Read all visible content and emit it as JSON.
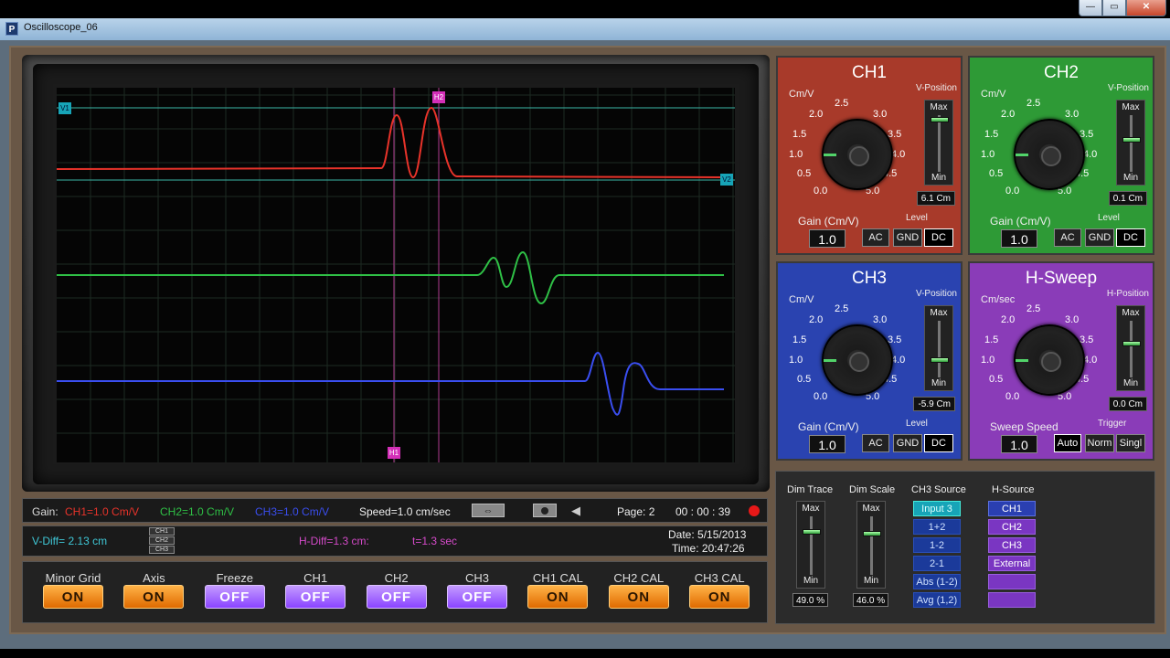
{
  "window": {
    "title": "Oscilloscope_06"
  },
  "screen": {
    "markers": {
      "v1": "V1",
      "v2": "V2",
      "h1": "H1",
      "h2": "H2"
    },
    "traces": {
      "ch1_color": "#e8332a",
      "ch2_color": "#2fc046",
      "ch3_color": "#3a4ef0"
    }
  },
  "gainbar": {
    "gain_label": "Gain:",
    "ch1": "CH1=1.0 Cm/V",
    "ch2": "CH2=1.0 Cm/V",
    "ch3": "CH3=1.0 Cm/V",
    "speed": "Speed=1.0 cm/sec",
    "page": "Page: 2",
    "timer": "00 : 00 : 39"
  },
  "diffbar": {
    "vdiff": "V-Diff= 2.13 cm",
    "mini": [
      "CH1",
      "CH2",
      "CH3"
    ],
    "hdiff": "H-Diff=1.3 cm:",
    "t": "t=1.3 sec",
    "date": "Date: 5/15/2013",
    "time": "Time: 20:47:26"
  },
  "toggles": [
    {
      "label": "Minor Grid",
      "state": "ON"
    },
    {
      "label": "Axis",
      "state": "ON"
    },
    {
      "label": "Freeze",
      "state": "OFF"
    },
    {
      "label": "CH1",
      "state": "OFF"
    },
    {
      "label": "CH2",
      "state": "OFF"
    },
    {
      "label": "CH3",
      "state": "OFF"
    },
    {
      "label": "CH1 CAL",
      "state": "ON"
    },
    {
      "label": "CH2 CAL",
      "state": "ON"
    },
    {
      "label": "CH3 CAL",
      "state": "ON"
    }
  ],
  "knob_ticks": [
    "0.0",
    "0.5",
    "1.0",
    "1.5",
    "2.0",
    "2.5",
    "3.0",
    "3.5",
    "4.0",
    "4.5",
    "5.0"
  ],
  "panels": {
    "ch1": {
      "title": "CH1",
      "unit": "Cm/V",
      "vpos_label": "V-Position",
      "max": "Max",
      "min": "Min",
      "readout": "6.1 Cm",
      "gain_label": "Gain (Cm/V)",
      "gain": "1.0",
      "level_label": "Level",
      "levels": [
        "AC",
        "GND",
        "DC"
      ],
      "color": "#a83a2a"
    },
    "ch2": {
      "title": "CH2",
      "unit": "Cm/V",
      "vpos_label": "V-Position",
      "max": "Max",
      "min": "Min",
      "readout": "0.1 Cm",
      "gain_label": "Gain (Cm/V)",
      "gain": "1.0",
      "level_label": "Level",
      "levels": [
        "AC",
        "GND",
        "DC"
      ],
      "color": "#2e9a36"
    },
    "ch3": {
      "title": "CH3",
      "unit": "Cm/V",
      "vpos_label": "V-Position",
      "max": "Max",
      "min": "Min",
      "readout": "-5.9 Cm",
      "gain_label": "Gain (Cm/V)",
      "gain": "1.0",
      "level_label": "Level",
      "levels": [
        "AC",
        "GND",
        "DC"
      ],
      "color": "#2a43b0"
    },
    "hsweep": {
      "title": "H-Sweep",
      "unit": "Cm/sec",
      "vpos_label": "H-Position",
      "max": "Max",
      "min": "Min",
      "readout": "0.0 Cm",
      "gain_label": "Sweep Speed",
      "gain": "1.0",
      "level_label": "Trigger",
      "levels": [
        "Auto",
        "Norm",
        "Singl"
      ],
      "color": "#8a3cb8"
    }
  },
  "lower": {
    "dim_trace": {
      "title": "Dim Trace",
      "max": "Max",
      "min": "Min",
      "readout": "49.0 %"
    },
    "dim_scale": {
      "title": "Dim Scale",
      "max": "Max",
      "min": "Min",
      "readout": "46.0 %"
    },
    "ch3_source": {
      "title": "CH3 Source",
      "items": [
        "Input 3",
        "1+2",
        "1-2",
        "2-1",
        "Abs (1-2)",
        "Avg (1,2)"
      ]
    },
    "h_source": {
      "title": "H-Source",
      "items": [
        "CH1",
        "CH2",
        "CH3",
        "External",
        "",
        ""
      ]
    }
  }
}
